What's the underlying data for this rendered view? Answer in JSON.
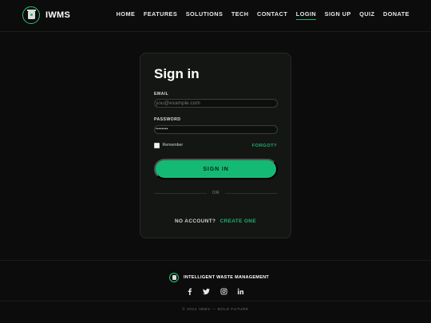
{
  "brand": {
    "name": "IWMS",
    "logo_icon": "waste-bin-logo-icon"
  },
  "nav": {
    "items": [
      {
        "label": "HOME"
      },
      {
        "label": "FEATURES"
      },
      {
        "label": "SOLUTIONS"
      },
      {
        "label": "TECH"
      },
      {
        "label": "CONTACT"
      },
      {
        "label": "LOGIN",
        "active": true
      },
      {
        "label": "SIGN UP"
      },
      {
        "label": "QUIZ"
      },
      {
        "label": "DONATE"
      }
    ]
  },
  "form": {
    "title": "Sign in",
    "email_label": "EMAIL",
    "email_placeholder": "you@example.com",
    "password_label": "PASSWORD",
    "password_value": "••••••••",
    "remember_label": "Remember",
    "remember_checked": false,
    "forgot_label": "FORGOT?",
    "submit_label": "SIGN IN",
    "divider_text": "OR",
    "no_account_text": "NO ACCOUNT?",
    "create_link": "CREATE ONE"
  },
  "footer": {
    "brand_text": "INTELLIGENT WASTE MANAGEMENT",
    "socials": [
      "facebook-icon",
      "twitter-icon",
      "instagram-icon",
      "linkedin-icon"
    ],
    "copyright": "© 2024 IWMS — BOLD FUTURE"
  },
  "colors": {
    "accent": "#14ba74",
    "background": "#0b0c0b",
    "card": "#141614"
  }
}
